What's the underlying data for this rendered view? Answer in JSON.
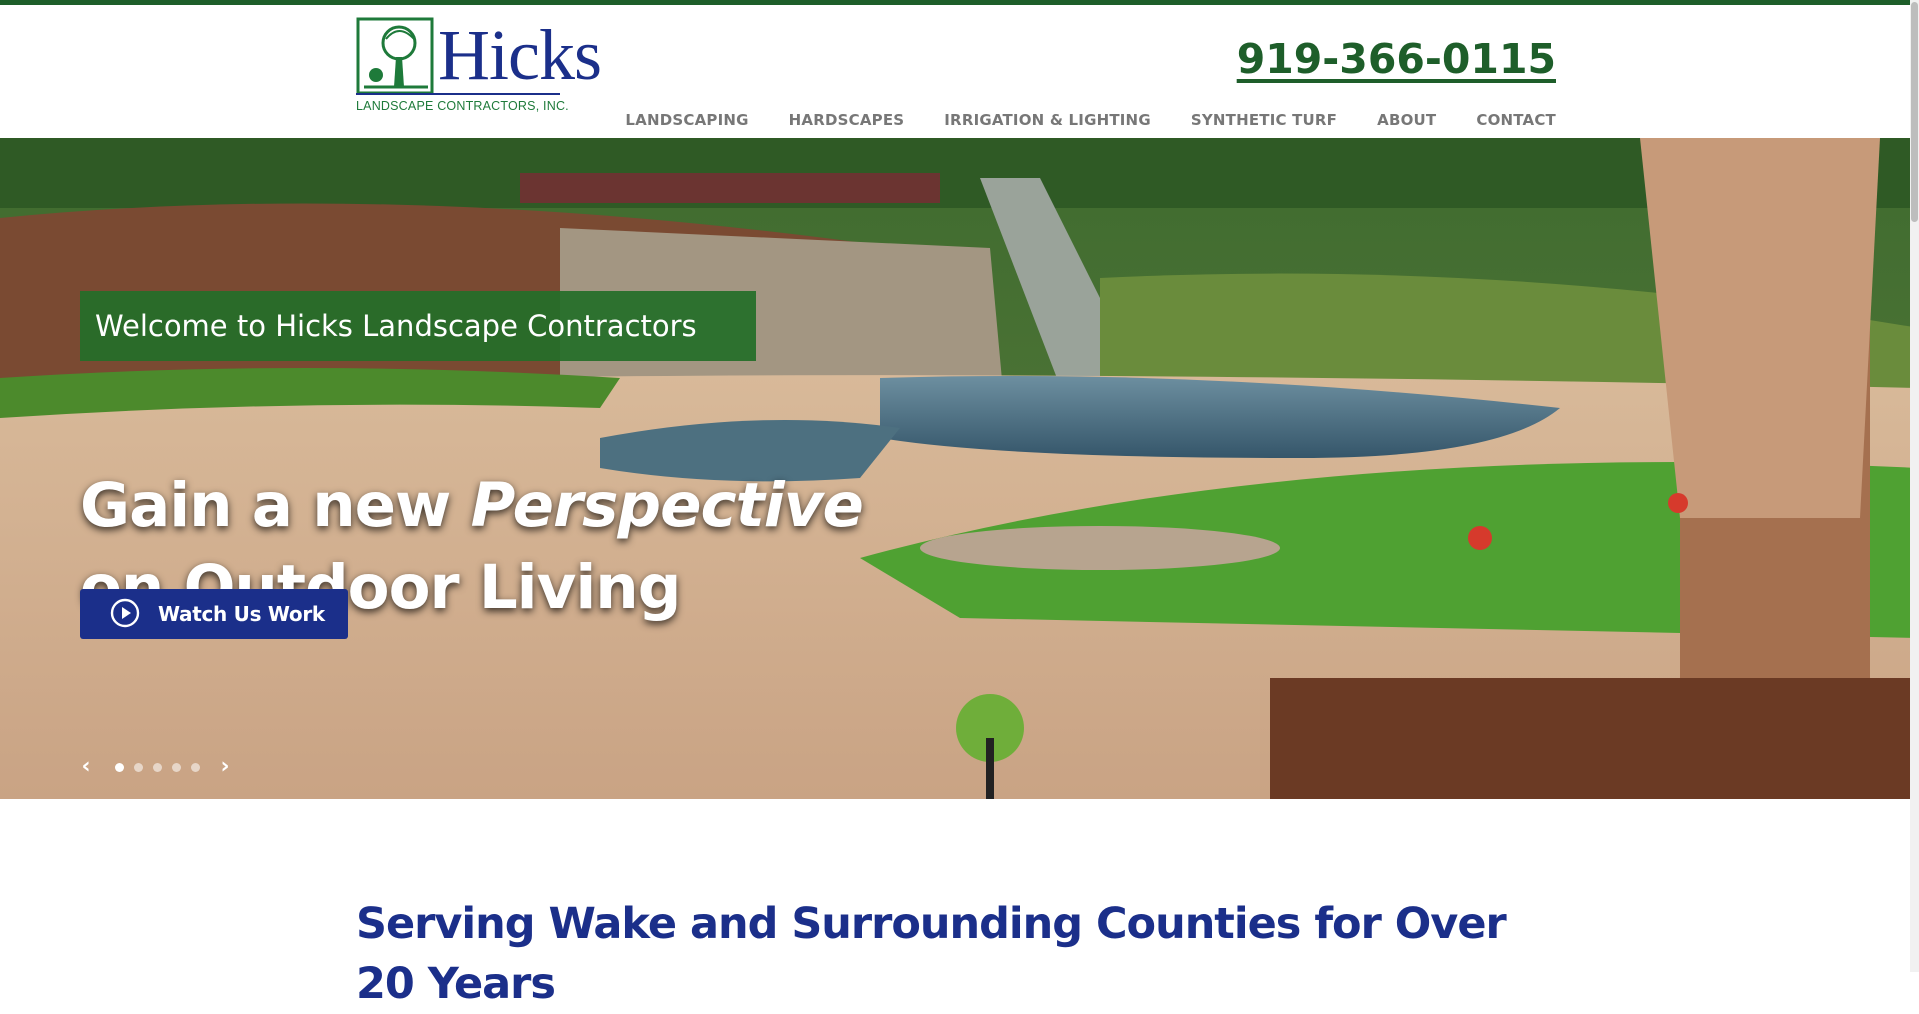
{
  "brand": {
    "name": "Hicks",
    "subtitle": "LANDSCAPE CONTRACTORS, INC."
  },
  "header": {
    "phone": "919-366-0115",
    "nav": [
      {
        "label": "LANDSCAPING"
      },
      {
        "label": "HARDSCAPES"
      },
      {
        "label": "IRRIGATION & LIGHTING"
      },
      {
        "label": "SYNTHETIC TURF"
      },
      {
        "label": "ABOUT"
      },
      {
        "label": "CONTACT"
      }
    ]
  },
  "hero": {
    "welcome": "Welcome to Hicks Landscape Contractors",
    "headline_part1": "Gain a new ",
    "headline_emphasis": "Perspective",
    "headline_line2": "on Outdoor Living",
    "cta_label": "Watch Us Work",
    "slides": {
      "count": 5,
      "active": 1
    },
    "prev_icon": "chevron-left-icon",
    "next_icon": "chevron-right-icon"
  },
  "intro": {
    "heading": "Serving Wake and Surrounding Counties for Over 20 Years"
  },
  "colors": {
    "brand_green": "#1e5e2a",
    "brand_blue": "#1b2f8a",
    "nav_gray": "#777777"
  }
}
